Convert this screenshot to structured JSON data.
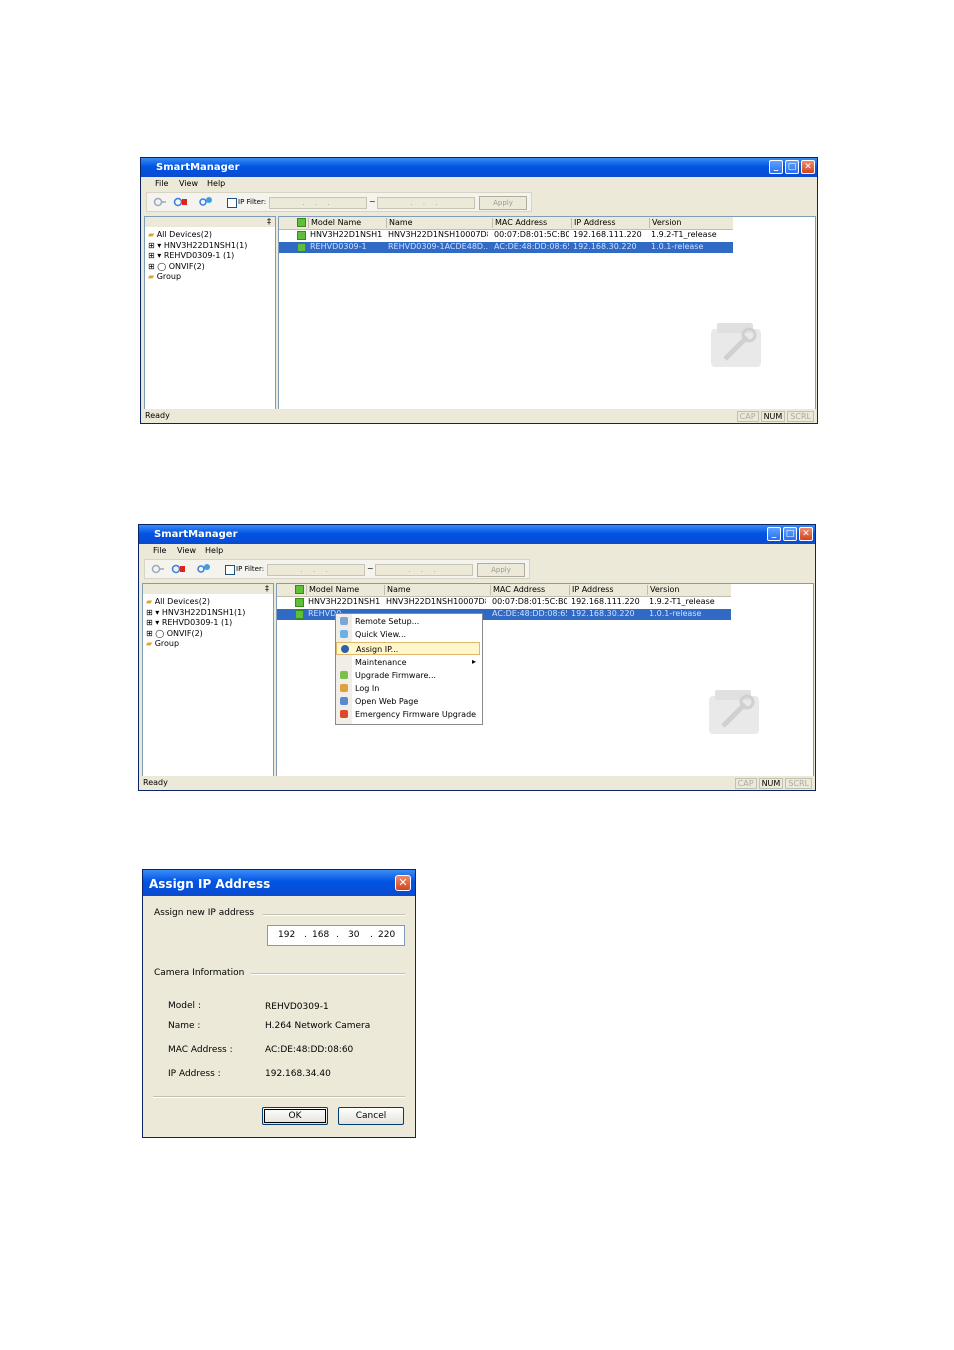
{
  "window1": {
    "title": "SmartManager",
    "menu": [
      "File",
      "View",
      "Help"
    ],
    "ip_filter_label": "IP Filter:",
    "ip_from": ". . .",
    "ip_sep": "~",
    "ip_to": ". . .",
    "apply": "Apply",
    "pin": "‡",
    "tree": [
      "All Devices(2)",
      "HNV3H22D1NSH1(1)",
      "REHVD0309-1 (1)",
      "ONVIF(2)",
      "Group"
    ],
    "columns": [
      "Model Name",
      "Name",
      "MAC Address",
      "IP Address",
      "Version"
    ],
    "rows": [
      [
        "HNV3H22D1NSH1",
        "HNV3H22D1NSH10007D80...",
        "00:07:D8:01:5C:B0",
        "192.168.111.220",
        "1.9.2-T1_release"
      ],
      [
        "REHVD0309-1",
        "REHVD0309-1ACDE48D...",
        "AC:DE:48:DD:08:65",
        "192.168.30.220",
        "1.0.1-release"
      ]
    ],
    "status": "Ready",
    "indicators": [
      "CAP",
      "NUM",
      "SCRL"
    ]
  },
  "window2": {
    "title": "SmartManager",
    "menu": [
      "File",
      "View",
      "Help"
    ],
    "ip_filter_label": "IP Filter:",
    "ip_from": ". . .",
    "ip_sep": "~",
    "ip_to": ". . .",
    "apply": "Apply",
    "pin": "‡",
    "tree": [
      "All Devices(2)",
      "HNV3H22D1NSH1(1)",
      "REHVD0309-1 (1)",
      "ONVIF(2)",
      "Group"
    ],
    "columns": [
      "Model Name",
      "Name",
      "MAC Address",
      "IP Address",
      "Version"
    ],
    "rows": [
      [
        "HNV3H22D1NSH1",
        "HNV3H22D1NSH10007D80...",
        "00:07:D8:01:5C:B0",
        "192.168.111.220",
        "1.9.2-T1_release"
      ],
      [
        "REHVD0",
        "",
        "AC:DE:48:DD:08:65",
        "192.168.30.220",
        "1.0.1-release"
      ]
    ],
    "context_menu": [
      "Remote Setup...",
      "Quick View...",
      "Assign IP...",
      "Maintenance",
      "Upgrade Firmware...",
      "Log In",
      "Open Web Page",
      "Emergency Firmware Upgrade"
    ],
    "submenu_arrow": "▸",
    "status": "Ready",
    "indicators": [
      "CAP",
      "NUM",
      "SCRL"
    ]
  },
  "dialog": {
    "title": "Assign IP Address",
    "close": "✕",
    "section1": "Assign new IP address",
    "ip": [
      "192",
      "168",
      "30",
      "220"
    ],
    "dot": ".",
    "section2": "Camera Information",
    "labels": [
      "Model :",
      "Name :",
      "MAC Address :",
      "IP Address :"
    ],
    "values": [
      "REHVD0309-1",
      "H.264 Network Camera",
      "AC:DE:48:DD:08:60",
      "192.168.34.40"
    ],
    "ok": "OK",
    "cancel": "Cancel"
  },
  "colors": {
    "titlebar": "#0054e3",
    "selection": "#316ac5",
    "face": "#ece9d8"
  }
}
